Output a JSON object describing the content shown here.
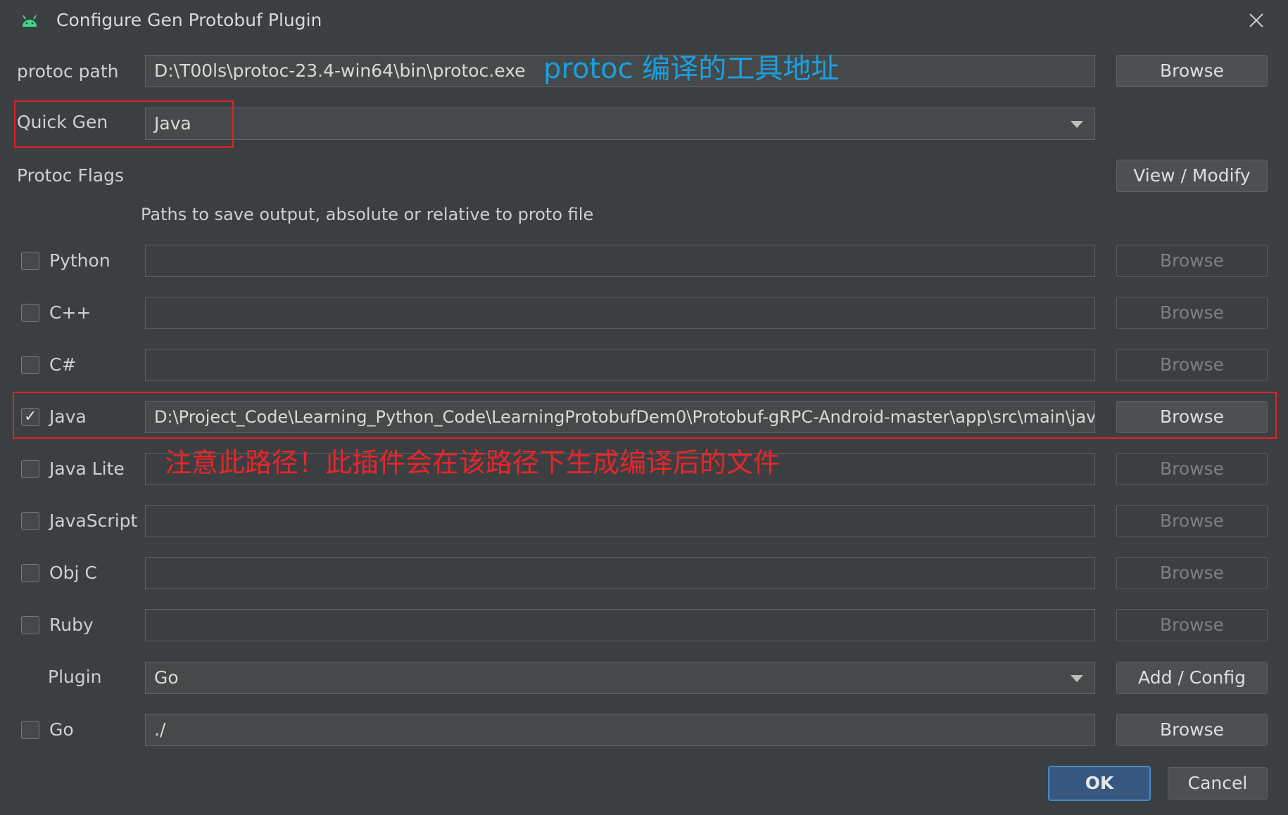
{
  "window": {
    "title": "Configure Gen Protobuf Plugin",
    "app_icon": "android-icon",
    "close_icon": "close-icon"
  },
  "protoc": {
    "label": "protoc path",
    "value": "D:\\T00ls\\protoc-23.4-win64\\bin\\protoc.exe",
    "browse_label": "Browse"
  },
  "quick_gen": {
    "label": "Quick Gen",
    "value": "Java"
  },
  "protoc_flags": {
    "label": "Protoc Flags",
    "button_label": "View / Modify"
  },
  "paths_hint": "Paths to save output, absolute or relative to proto file",
  "languages": [
    {
      "label": "Python",
      "checked": false,
      "value": "",
      "browse_label": "Browse"
    },
    {
      "label": "C++",
      "checked": false,
      "value": "",
      "browse_label": "Browse"
    },
    {
      "label": "C#",
      "checked": false,
      "value": "",
      "browse_label": "Browse"
    },
    {
      "label": "Java",
      "checked": true,
      "value": "D:\\Project_Code\\Learning_Python_Code\\LearningProtobufDem0\\Protobuf-gRPC-Android-master\\app\\src\\main\\java",
      "browse_label": "Browse"
    },
    {
      "label": "Java Lite",
      "checked": false,
      "value": "",
      "browse_label": "Browse"
    },
    {
      "label": "JavaScript",
      "checked": false,
      "value": "",
      "browse_label": "Browse"
    },
    {
      "label": "Obj C",
      "checked": false,
      "value": "",
      "browse_label": "Browse"
    },
    {
      "label": "Ruby",
      "checked": false,
      "value": "",
      "browse_label": "Browse"
    }
  ],
  "plugin": {
    "label": "Plugin",
    "value": "Go",
    "button_label": "Add / Config"
  },
  "go": {
    "label": "Go",
    "checked": false,
    "value": "./",
    "browse_label": "Browse"
  },
  "footer": {
    "ok_label": "OK",
    "cancel_label": "Cancel"
  },
  "annotations": {
    "protoc_note": "protoc 编译的工具地址",
    "java_note": "注意此路径！此插件会在该路径下生成编译后的文件"
  },
  "colors": {
    "background": "#3c3f41",
    "annotation_blue": "#1a9fe0",
    "annotation_red": "#e8252b",
    "ok_button": "#365880"
  }
}
